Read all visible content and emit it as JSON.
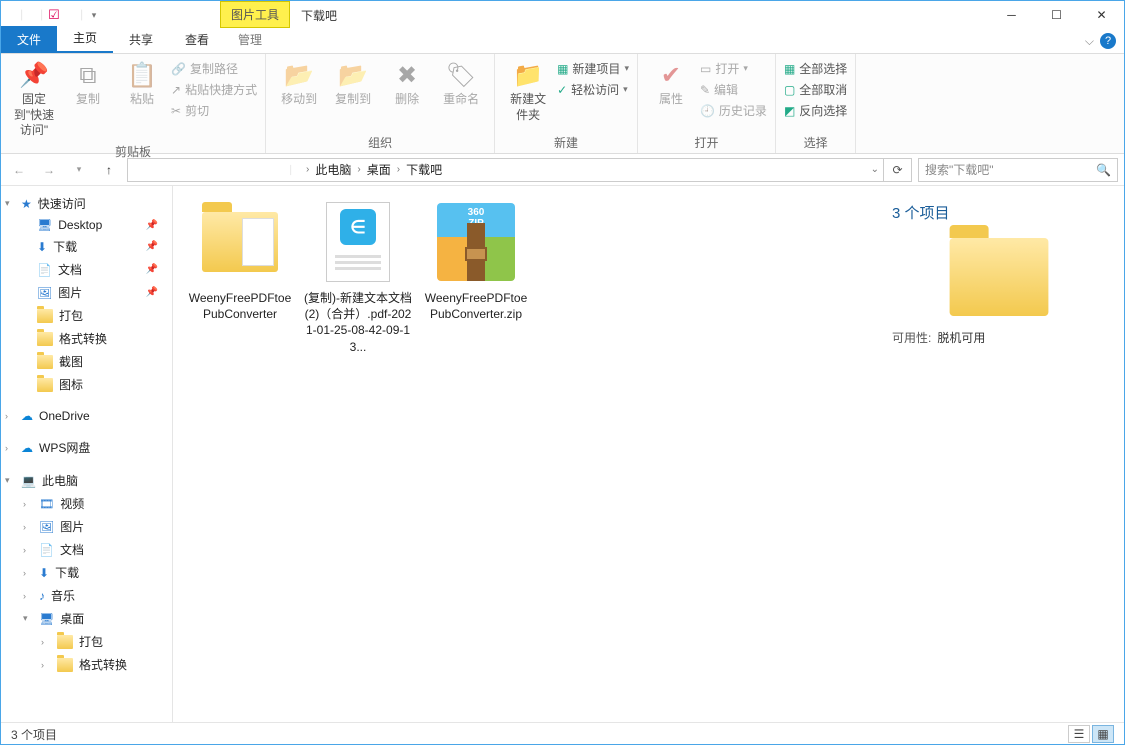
{
  "titlebar": {
    "tool_tab": "图片工具",
    "title": "下载吧"
  },
  "tabs": {
    "file": "文件",
    "home": "主页",
    "share": "共享",
    "view": "查看",
    "manage": "管理"
  },
  "ribbon": {
    "pin": "固定到\"快速访问\"",
    "copy": "复制",
    "paste": "粘贴",
    "copy_path": "复制路径",
    "paste_shortcut": "粘贴快捷方式",
    "cut": "剪切",
    "group_clipboard": "剪贴板",
    "move_to": "移动到",
    "copy_to": "复制到",
    "delete": "删除",
    "rename": "重命名",
    "group_organize": "组织",
    "new_folder": "新建文件夹",
    "new_item": "新建项目",
    "easy_access": "轻松访问",
    "group_new": "新建",
    "properties": "属性",
    "open": "打开",
    "edit": "编辑",
    "history": "历史记录",
    "group_open": "打开",
    "select_all": "全部选择",
    "select_none": "全部取消",
    "invert": "反向选择",
    "group_select": "选择"
  },
  "breadcrumb": {
    "this_pc": "此电脑",
    "desktop": "桌面",
    "current": "下载吧"
  },
  "search": {
    "placeholder": "搜索\"下载吧\""
  },
  "nav": {
    "quick": "快速访问",
    "desktop": "Desktop",
    "downloads": "下载",
    "documents": "文档",
    "pictures": "图片",
    "pack": "打包",
    "format": "格式转换",
    "screenshot": "截图",
    "icons": "图标",
    "onedrive": "OneDrive",
    "wps": "WPS网盘",
    "thispc": "此电脑",
    "videos": "视频",
    "pictures2": "图片",
    "documents2": "文档",
    "downloads2": "下载",
    "music": "音乐",
    "desktop2": "桌面",
    "pack2": "打包",
    "format2": "格式转换"
  },
  "files": [
    {
      "name": "WeenyFreePDFtoePubConverter"
    },
    {
      "name": "(复制)-新建文本文档 (2)（合并）.pdf-2021-01-25-08-42-09-13..."
    },
    {
      "name": "WeenyFreePDFtoePubConverter.zip"
    }
  ],
  "details": {
    "count": "3 个项目",
    "avail_label": "可用性:",
    "avail_value": "脱机可用"
  },
  "status": {
    "text": "3 个项目"
  }
}
